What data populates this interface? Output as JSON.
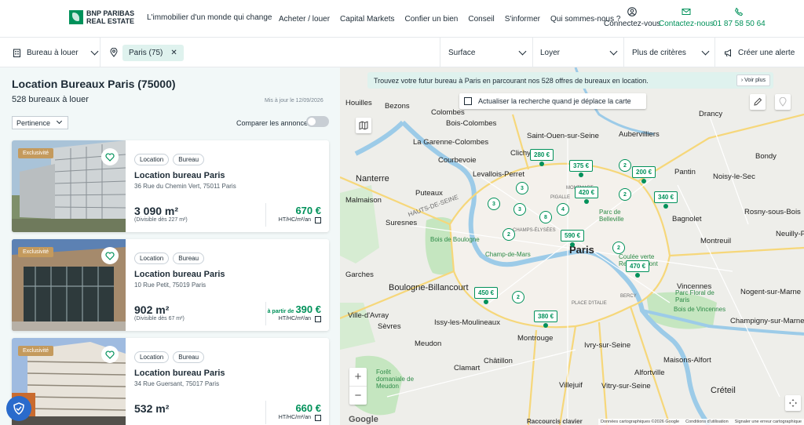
{
  "header": {
    "logo_line1": "BNP PARIBAS",
    "logo_line2": "REAL ESTATE",
    "tagline": "L'immobilier d'un monde qui change",
    "menu": [
      "Acheter / louer",
      "Capital Markets",
      "Confier un bien",
      "Conseil",
      "S'informer",
      "Qui sommes-nous ?"
    ],
    "connect_label": "Connectez-vous",
    "contact_label": "Contactez-nous",
    "phone": "01 87 58 50 64"
  },
  "filters": {
    "type": "Bureau à louer",
    "location_chip": "Paris (75)",
    "surface": "Surface",
    "loyer": "Loyer",
    "more": "Plus de critères",
    "alert": "Créer une alerte"
  },
  "listing": {
    "title": "Location Bureaux Paris (75000)",
    "count": "528 bureaux à louer",
    "updated": "Mis à jour le 12/09/2026",
    "sort": "Pertinence",
    "compare": "Comparer les annonces",
    "cards": [
      {
        "badge": "Exclusivité",
        "tags": [
          "Location",
          "Bureau"
        ],
        "title": "Location bureau Paris",
        "address": "36 Rue du Chemin Vert, 75011 Paris",
        "area": "3 090 m²",
        "divisible": "(Divisible dès 227 m²)",
        "price_prefix": "",
        "price": "670 €",
        "unit": "HT/HC/m²/an"
      },
      {
        "badge": "Exclusivité",
        "tags": [
          "Location",
          "Bureau"
        ],
        "title": "Location bureau Paris",
        "address": "10 Rue Petit, 75019 Paris",
        "area": "902 m²",
        "divisible": "(Divisible dès 67 m²)",
        "price_prefix": "à partir de",
        "price": "390 €",
        "unit": "HT/HC/m²/an"
      },
      {
        "badge": "Exclusivité",
        "tags": [
          "Location",
          "Bureau"
        ],
        "title": "Location bureau Paris",
        "address": "34 Rue Guersant, 75017 Paris",
        "area": "532 m²",
        "divisible": "",
        "price_prefix": "",
        "price": "660 €",
        "unit": "HT/HC/m²/an"
      }
    ]
  },
  "map": {
    "banner": "Trouvez votre futur bureau à Paris en parcourant nos 528 offres de bureaux en location.",
    "voir_plus": "Voir plus",
    "search_area": "Actualiser la recherche quand je déplace la carte",
    "zoom_in": "+",
    "zoom_out": "−",
    "google": "Google",
    "attribution": [
      "Données cartographiques ©2026 Google",
      "Conditions d'utilisation",
      "Signaler une erreur cartographique"
    ],
    "labels": {
      "houilles": "Houilles",
      "bezons": "Bezons",
      "colombes": "Colombes",
      "bois_colombes": "Bois-Colombes",
      "garenne": "La Garenne-Colombes",
      "courbevoie": "Courbevoie",
      "nanterre": "Nanterre",
      "puteaux": "Puteaux",
      "malmaison": "Malmaison",
      "suresnes": "Suresnes",
      "bois_boulogne": "Bois de Boulogne",
      "garches": "Garches",
      "boulogne": "Boulogne-Billancourt",
      "ville_avray": "Ville-d'Avray",
      "sevres": "Sèvres",
      "issy": "Issy-les-Moulineaux",
      "meudon": "Meudon",
      "clamart": "Clamart",
      "chatillon": "Châtillon",
      "montrouge": "Montrouge",
      "foret_meudon": "Forêt domaniale de Meudon",
      "clichy": "Clichy",
      "levallois": "Levallois-Perret",
      "saint_ouen": "Saint-Ouen-sur-Seine",
      "aubervilliers": "Aubervilliers",
      "drancy": "Drancy",
      "pantin": "Pantin",
      "bondy": "Bondy",
      "noisy": "Noisy-le-Sec",
      "bagnolet": "Bagnolet",
      "rosny": "Rosny-sous-Bois",
      "montreuil": "Montreuil",
      "neuilly": "Neuilly-P",
      "paris": "Paris",
      "champ_mars": "Champ-de-Mars",
      "belleville": "Parc de Belleville",
      "coulee": "Coulée verte René-Dumont",
      "vincennes": "Vincennes",
      "parc_floral": "Parc Floral de Paris",
      "bois_vincennes": "Bois de Vincennes",
      "nogent": "Nogent-sur-Marne",
      "champigny": "Champigny-sur-Marne",
      "ivry": "Ivry-sur-Seine",
      "maisons_alfort": "Maisons-Alfort",
      "alfortville": "Alfortville",
      "vitry": "Vitry-sur-Seine",
      "villejuif": "Villejuif",
      "creteil": "Créteil",
      "raccourcis": "Raccourcis clavier",
      "hauts_de_seine": "HAUTS-DE-SEINE",
      "bercy": "BERCY",
      "montmartre": "MONTMART",
      "pigalle": "PIGALLE",
      "place_italie": "PLACE D'ITALIE",
      "champs": "CHAMPS-ÉLYSÉES"
    },
    "price_pins": [
      "280 €",
      "375 €",
      "200 €",
      "420 €",
      "340 €",
      "590 €",
      "470 €",
      "450 €",
      "380 €"
    ],
    "clusters": [
      "2",
      "3",
      "3",
      "3",
      "8",
      "4",
      "2",
      "2",
      "2",
      "2",
      "2"
    ]
  },
  "colors": {
    "brand": "#00915a",
    "panel_bg": "#f2f8f8",
    "badge": "#c49a5d"
  }
}
